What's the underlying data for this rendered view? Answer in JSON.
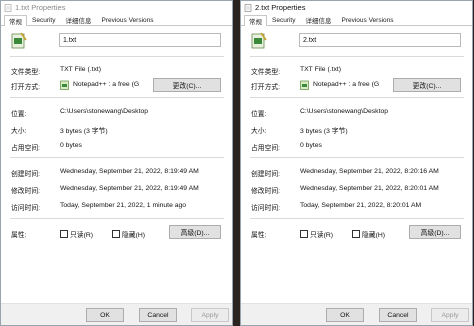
{
  "left": {
    "title": "1.txt Properties",
    "tabs": [
      "常规",
      "Security",
      "详细信息",
      "Previous Versions"
    ],
    "filename": "1.txt",
    "rows": {
      "type_label": "文件类型:",
      "type_value": "TXT File (.txt)",
      "open_label": "打开方式:",
      "open_app": "Notepad++ : a free (G",
      "change_button": "更改(C)...",
      "location_label": "位置:",
      "location_value": "C:\\Users\\stonewang\\Desktop",
      "size_label": "大小:",
      "size_value": "3 bytes (3 字节)",
      "disk_label": "占用空间:",
      "disk_value": "0 bytes",
      "created_label": "创建时间:",
      "created_value": "Wednesday, September 21, 2022, 8:19:49 AM",
      "modified_label": "修改时间:",
      "modified_value": "Wednesday, September 21, 2022, 8:19:49 AM",
      "accessed_label": "访问时间:",
      "accessed_value": "Today, September 21, 2022, 1 minute ago",
      "attr_label": "属性:",
      "readonly_label": "只读(R)",
      "hidden_label": "隐藏(H)",
      "advanced_button": "高级(D)..."
    },
    "footer": {
      "ok": "OK",
      "cancel": "Cancel",
      "apply": "Apply"
    }
  },
  "right": {
    "title": "2.txt Properties",
    "tabs": [
      "常规",
      "Security",
      "详细信息",
      "Previous Versions"
    ],
    "filename": "2.txt",
    "rows": {
      "type_label": "文件类型:",
      "type_value": "TXT File (.txt)",
      "open_label": "打开方式:",
      "open_app": "Notepad++ : a free (G",
      "change_button": "更改(C)...",
      "location_label": "位置:",
      "location_value": "C:\\Users\\stonewang\\Desktop",
      "size_label": "大小:",
      "size_value": "3 bytes (3 字节)",
      "disk_label": "占用空间:",
      "disk_value": "0 bytes",
      "created_label": "创建时间:",
      "created_value": "Wednesday, September 21, 2022, 8:20:16 AM",
      "modified_label": "修改时间:",
      "modified_value": "Wednesday, September 21, 2022, 8:20:01 AM",
      "accessed_label": "访问时间:",
      "accessed_value": "Today, September 21, 2022, 8:20:01 AM",
      "attr_label": "属性:",
      "readonly_label": "只读(R)",
      "hidden_label": "隐藏(H)",
      "advanced_button": "高级(D)..."
    },
    "footer": {
      "ok": "OK",
      "cancel": "Cancel",
      "apply": "Apply"
    }
  },
  "colors": {
    "window_border": "#9aa4b0",
    "button_face": "#e1e1e1",
    "footer_bg": "#f0f0f0",
    "backdrop": "#2a2320"
  },
  "icons": {
    "file": "txt-file-icon",
    "app": "notepad-plus-plus-icon"
  }
}
